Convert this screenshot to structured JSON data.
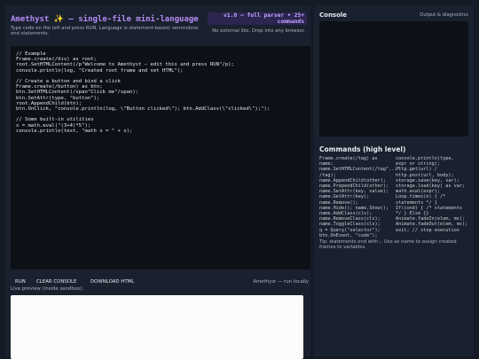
{
  "header": {
    "title": "Amethyst",
    "title_star": "✨",
    "title_rest": "— single-file mini-language",
    "subtitle": "Type code on the left and press RUN. Language is statement-based; semicolons end statements.",
    "badge": "v1.0 — full parser • 25+ commands",
    "note": "No external libs. Drop into any browser."
  },
  "editor": {
    "lines": [
      "// Example",
      "Frame.create(/div) as root;",
      "root.SetHTMLContent(/p\"Welcome to Amethyst — edit this and press RUN\"/p);",
      "console.println(log, \"Created root frame and set HTML\");",
      "",
      "// Create a button and bind a click",
      "Frame.create(/button) as btn;",
      "btn.SetHTMLContent(/span\"Click me\"/span);",
      "btn.SetAttr(type, \"button\");",
      "root.AppendChild(btn);",
      "btn.OnClick, \"console.println(log, \\\"Button clicked\\\"); btn.AddClass(\\\"clicked\\\");\");",
      "",
      "// Some built-in utilities",
      "x = math.eval(\"(3+4)*5\");",
      "console.println(text, \"math x = \" + x);"
    ]
  },
  "toolbar": {
    "run": "RUN",
    "clear": "CLEAR CONSOLE",
    "download": "DOWNLOAD HTML",
    "note": "Amethyst — run locally"
  },
  "preview": {
    "label": "Live preview (inside sandbox):"
  },
  "console": {
    "title": "Console",
    "note": "Output & diagnostics"
  },
  "commands": {
    "title": "Commands (high level)",
    "left": [
      "Frame.create(/tag) as",
      "name;",
      "name.SetHTMLContent(/tag\"...\"",
      "/tag);",
      "name.AppendChild(other);",
      "name.PrependChild(other);",
      "name.SetAttr(key, value);",
      "name.GetAttr(key);",
      "name.Remove();",
      "name.Hide(); name.Show();",
      "name.AddClass(cls);",
      "name.RemoveClass(cls);",
      "name.ToggleClass(cls);",
      "q = Query(\"selector\");",
      "btn.OnEvent, \"code\");"
    ],
    "right": [
      "console.println(type,",
      "expr or string);",
      "http.get(url) /",
      "http.post(url, body);",
      "storage.save(key, var);",
      "storage.load(key) as var;",
      "math.eval(expr);",
      "Loop.times(n) { /*",
      "statements */ }",
      "If(cond) { /* statements",
      "*/ } Else {}",
      "Animate.fadeIn(elem, ms);",
      "Animate.fadeOut(elem, ms);",
      "exit; // stop execution"
    ],
    "tip": "Tip: statements end with ;. Use as name to assign created frames to variables."
  }
}
